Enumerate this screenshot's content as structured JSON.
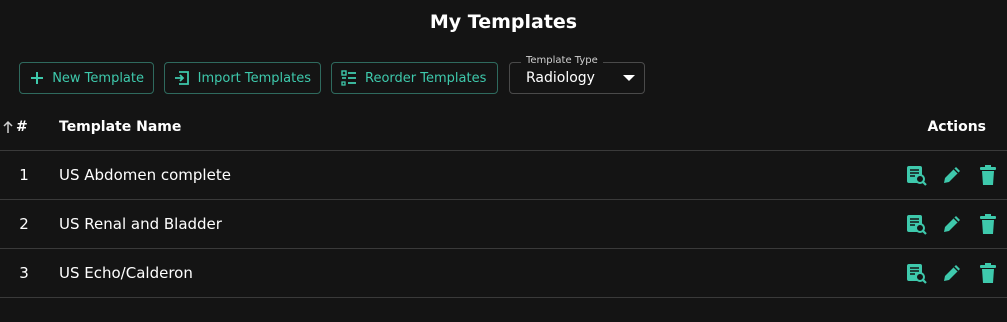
{
  "page_title": "My Templates",
  "colors": {
    "accent": "#3ec9ac",
    "background": "#141414",
    "divider": "#3a3a3a"
  },
  "toolbar": {
    "new_template_label": "New Template",
    "new_template_icon": "plus-icon",
    "import_templates_label": "Import Templates",
    "import_templates_icon": "import-icon",
    "reorder_templates_label": "Reorder Templates",
    "reorder_templates_icon": "reorder-list-icon",
    "template_type": {
      "label": "Template Type",
      "value": "Radiology"
    }
  },
  "table": {
    "columns": {
      "number": "#",
      "name": "Template Name",
      "actions": "Actions"
    },
    "sort_icon": "arrow-up-icon",
    "rows": [
      {
        "number": "1",
        "name": "US Abdomen complete"
      },
      {
        "number": "2",
        "name": "US Renal and Bladder"
      },
      {
        "number": "3",
        "name": "US Echo/Calderon"
      }
    ],
    "row_action_icons": [
      "preview-icon",
      "edit-pencil-icon",
      "delete-trash-icon"
    ]
  }
}
